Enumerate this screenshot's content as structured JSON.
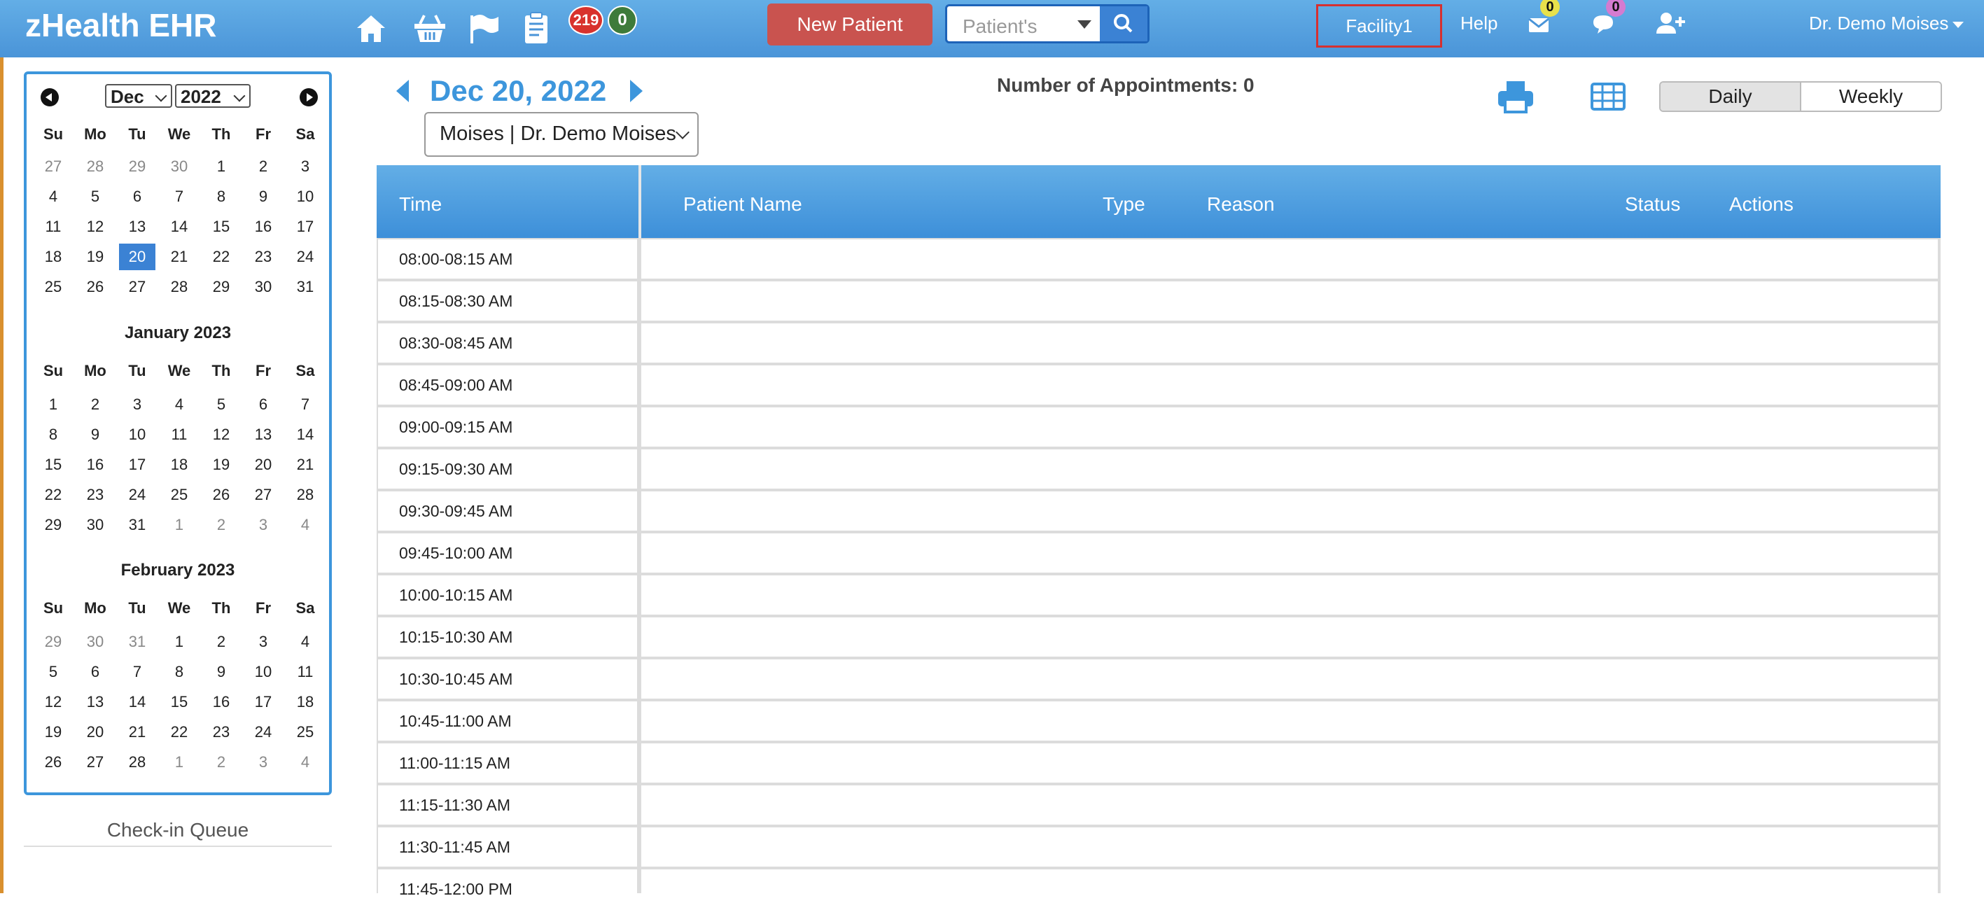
{
  "header": {
    "brand": "zHealth EHR",
    "icons": [
      "home-icon",
      "basket-icon",
      "flag-icon",
      "clipboard-icon"
    ],
    "badge_red": "219",
    "badge_green": "0",
    "new_patient_label": "New Patient",
    "patient_search_placeholder": "Patient's",
    "facility_label": "Facility1",
    "help_label": "Help",
    "mail_count": "0",
    "chat_count": "0",
    "user_label": "Dr. Demo Moises",
    "colors": {
      "bar": "#4a94d8",
      "new_patient": "#c9534f",
      "facility_border": "#d63030"
    }
  },
  "calendar": {
    "month_select": "Dec",
    "year_select": "2022",
    "dow": [
      "Su",
      "Mo",
      "Tu",
      "We",
      "Th",
      "Fr",
      "Sa"
    ],
    "selected_color": "#3b82d4",
    "months": [
      {
        "title": "",
        "weeks": [
          [
            [
              "27",
              1
            ],
            [
              "28",
              1
            ],
            [
              "29",
              1
            ],
            [
              "30",
              1
            ],
            [
              "1",
              0
            ],
            [
              "2",
              0
            ],
            [
              "3",
              0
            ]
          ],
          [
            [
              "4",
              0
            ],
            [
              "5",
              0
            ],
            [
              "6",
              0
            ],
            [
              "7",
              0
            ],
            [
              "8",
              0
            ],
            [
              "9",
              0
            ],
            [
              "10",
              0
            ]
          ],
          [
            [
              "11",
              0
            ],
            [
              "12",
              0
            ],
            [
              "13",
              0
            ],
            [
              "14",
              0
            ],
            [
              "15",
              0
            ],
            [
              "16",
              0
            ],
            [
              "17",
              0
            ]
          ],
          [
            [
              "18",
              0
            ],
            [
              "19",
              0
            ],
            [
              "20",
              2
            ],
            [
              "21",
              0
            ],
            [
              "22",
              0
            ],
            [
              "23",
              0
            ],
            [
              "24",
              0
            ]
          ],
          [
            [
              "25",
              0
            ],
            [
              "26",
              0
            ],
            [
              "27",
              0
            ],
            [
              "28",
              0
            ],
            [
              "29",
              0
            ],
            [
              "30",
              0
            ],
            [
              "31",
              0
            ]
          ]
        ]
      },
      {
        "title": "January 2023",
        "weeks": [
          [
            [
              "1",
              0
            ],
            [
              "2",
              0
            ],
            [
              "3",
              0
            ],
            [
              "4",
              0
            ],
            [
              "5",
              0
            ],
            [
              "6",
              0
            ],
            [
              "7",
              0
            ]
          ],
          [
            [
              "8",
              0
            ],
            [
              "9",
              0
            ],
            [
              "10",
              0
            ],
            [
              "11",
              0
            ],
            [
              "12",
              0
            ],
            [
              "13",
              0
            ],
            [
              "14",
              0
            ]
          ],
          [
            [
              "15",
              0
            ],
            [
              "16",
              0
            ],
            [
              "17",
              0
            ],
            [
              "18",
              0
            ],
            [
              "19",
              0
            ],
            [
              "20",
              0
            ],
            [
              "21",
              0
            ]
          ],
          [
            [
              "22",
              0
            ],
            [
              "23",
              0
            ],
            [
              "24",
              0
            ],
            [
              "25",
              0
            ],
            [
              "26",
              0
            ],
            [
              "27",
              0
            ],
            [
              "28",
              0
            ]
          ],
          [
            [
              "29",
              0
            ],
            [
              "30",
              0
            ],
            [
              "31",
              0
            ],
            [
              "1",
              1
            ],
            [
              "2",
              1
            ],
            [
              "3",
              1
            ],
            [
              "4",
              1
            ]
          ]
        ]
      },
      {
        "title": "February 2023",
        "weeks": [
          [
            [
              "29",
              1
            ],
            [
              "30",
              1
            ],
            [
              "31",
              1
            ],
            [
              "1",
              0
            ],
            [
              "2",
              0
            ],
            [
              "3",
              0
            ],
            [
              "4",
              0
            ]
          ],
          [
            [
              "5",
              0
            ],
            [
              "6",
              0
            ],
            [
              "7",
              0
            ],
            [
              "8",
              0
            ],
            [
              "9",
              0
            ],
            [
              "10",
              0
            ],
            [
              "11",
              0
            ]
          ],
          [
            [
              "12",
              0
            ],
            [
              "13",
              0
            ],
            [
              "14",
              0
            ],
            [
              "15",
              0
            ],
            [
              "16",
              0
            ],
            [
              "17",
              0
            ],
            [
              "18",
              0
            ]
          ],
          [
            [
              "19",
              0
            ],
            [
              "20",
              0
            ],
            [
              "21",
              0
            ],
            [
              "22",
              0
            ],
            [
              "23",
              0
            ],
            [
              "24",
              0
            ],
            [
              "25",
              0
            ]
          ],
          [
            [
              "26",
              0
            ],
            [
              "27",
              0
            ],
            [
              "28",
              0
            ],
            [
              "1",
              1
            ],
            [
              "2",
              1
            ],
            [
              "3",
              1
            ],
            [
              "4",
              1
            ]
          ]
        ]
      }
    ],
    "checkin_title": "Check-in Queue"
  },
  "main": {
    "date_title": "Dec 20, 2022",
    "appointments_label": "Number of Appointments: 0",
    "provider_select": "Moises | Dr. Demo Moises",
    "view_daily": "Daily",
    "view_weekly": "Weekly",
    "active_view": "Daily"
  },
  "table": {
    "columns": {
      "time": "Time",
      "patient_name": "Patient Name",
      "type": "Type",
      "reason": "Reason",
      "status": "Status",
      "actions": "Actions"
    },
    "slots": [
      "08:00-08:15 AM",
      "08:15-08:30 AM",
      "08:30-08:45 AM",
      "08:45-09:00 AM",
      "09:00-09:15 AM",
      "09:15-09:30 AM",
      "09:30-09:45 AM",
      "09:45-10:00 AM",
      "10:00-10:15 AM",
      "10:15-10:30 AM",
      "10:30-10:45 AM",
      "10:45-11:00 AM",
      "11:00-11:15 AM",
      "11:15-11:30 AM",
      "11:30-11:45 AM",
      "11:45-12:00 PM"
    ]
  }
}
